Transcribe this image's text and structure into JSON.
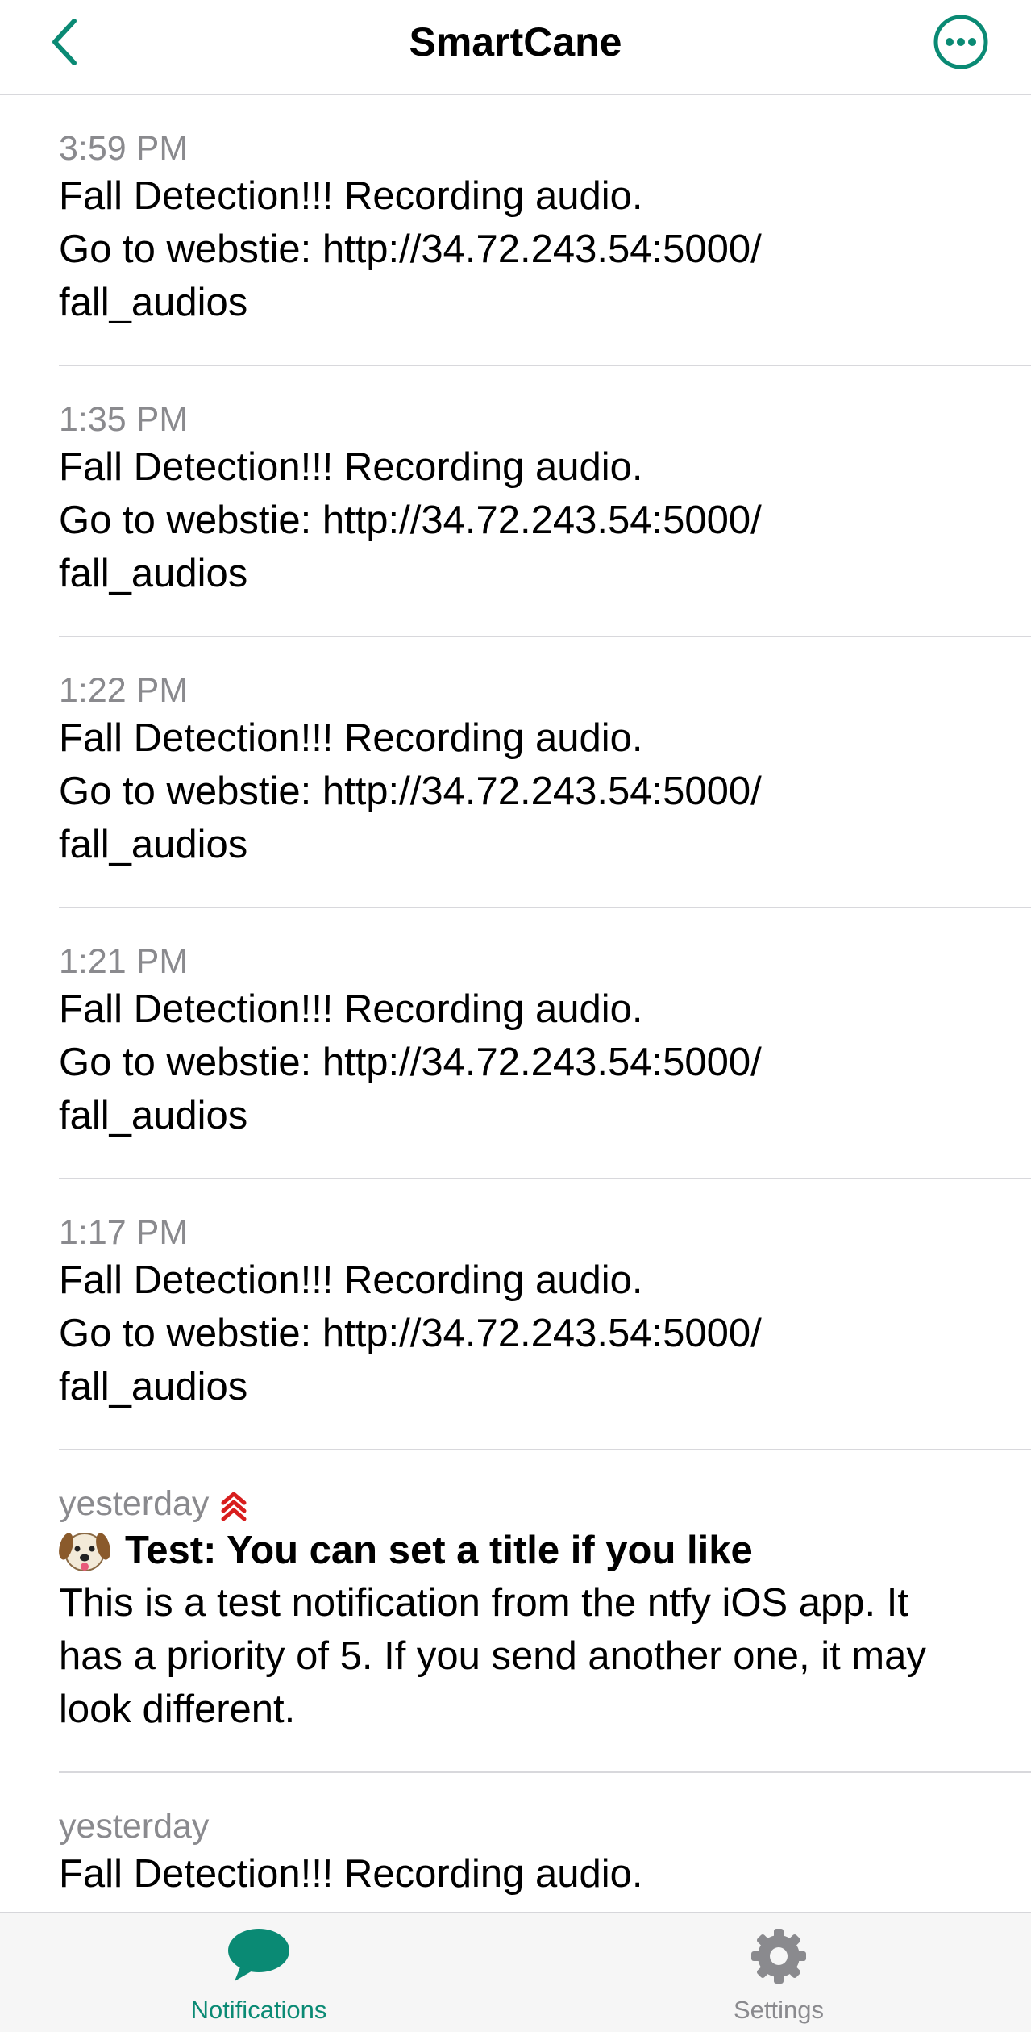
{
  "colors": {
    "accent": "#0a8a74",
    "priority": "#d81e1e",
    "timestamp": "#8a8a8e",
    "inactive_tab": "#8a8a8e"
  },
  "nav": {
    "title": "SmartCane",
    "back_icon": "chevron-left-icon",
    "more_icon": "ellipsis-circle-icon"
  },
  "notifications": [
    {
      "time": "3:59 PM",
      "message": "Fall Detection!!! Recording audio.\nGo to webstie: http://34.72.243.54:5000/\nfall_audios"
    },
    {
      "time": "1:35 PM",
      "message": "Fall Detection!!! Recording audio.\nGo to webstie: http://34.72.243.54:5000/\nfall_audios"
    },
    {
      "time": "1:22 PM",
      "message": "Fall Detection!!! Recording audio.\nGo to webstie: http://34.72.243.54:5000/\nfall_audios"
    },
    {
      "time": "1:21 PM",
      "message": "Fall Detection!!! Recording audio.\nGo to webstie: http://34.72.243.54:5000/\nfall_audios"
    },
    {
      "time": "1:17 PM",
      "message": "Fall Detection!!! Recording audio.\nGo to webstie: http://34.72.243.54:5000/\nfall_audios"
    },
    {
      "time": "yesterday",
      "priority_icon": "priority-max-icon",
      "emoji_icon": "dog-face-icon",
      "title": "Test: You can set a title if you like",
      "message": "This is a test notification from the ntfy iOS app. It\nhas a priority of 5. If you send another one, it may\nlook different."
    },
    {
      "time": "yesterday",
      "message": "Fall Detection!!! Recording audio."
    }
  ],
  "tabbar": {
    "notifications": {
      "label": "Notifications",
      "icon": "chat-bubble-icon"
    },
    "settings": {
      "label": "Settings",
      "icon": "gear-icon"
    }
  }
}
